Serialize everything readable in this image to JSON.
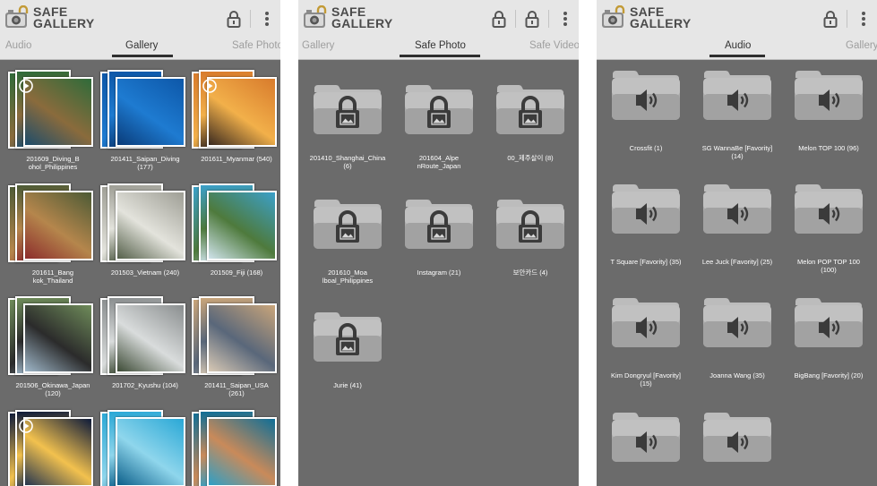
{
  "app": {
    "title": "SAFE\nGALLERY"
  },
  "icons": {
    "logo": "safe-camera-logo-icon",
    "lock": "lock-icon",
    "menu": "more-vert-icon",
    "play": "play-icon",
    "folder_lock": "folder-lock-icon",
    "folder_audio": "folder-speaker-icon"
  },
  "colors": {
    "background": "#6b6b6b",
    "toolbar": "#e6e6e6",
    "tab_active": "#333333",
    "tab_inactive": "#9e9e9e",
    "indicator": "#2f2f2f"
  },
  "screens": [
    {
      "tabs": [
        "Audio",
        "Gallery",
        "Safe Photo"
      ],
      "items": [
        {
          "label": "201609_Diving_B\nohol_Philippines",
          "video": true,
          "c": [
            "#2f6b3a",
            "#8a6b3c",
            "#1d4c6b"
          ]
        },
        {
          "label": "201411_Saipan_Diving\n(177)",
          "video": false,
          "c": [
            "#0d57a8",
            "#1e7bd1",
            "#0a3b78"
          ]
        },
        {
          "label": "201611_Myanmar (540)",
          "video": true,
          "c": [
            "#d87b2c",
            "#f2b04a",
            "#3a2a20"
          ]
        },
        {
          "label": "201611_Bang\nkok_Thailand",
          "video": false,
          "c": [
            "#4c5a35",
            "#b5864c",
            "#8c2c2c"
          ]
        },
        {
          "label": "201503_Vietnam (240)",
          "video": false,
          "c": [
            "#9e9e95",
            "#e3e3dc",
            "#55604a"
          ]
        },
        {
          "label": "201509_Fiji (168)",
          "video": false,
          "c": [
            "#3ba0c9",
            "#4e7a3c",
            "#cfe3ea"
          ]
        },
        {
          "label": "201506_Okinawa_Japan\n(120)",
          "video": false,
          "c": [
            "#6f8c5a",
            "#2b2b2b",
            "#9fb7c9"
          ]
        },
        {
          "label": "201702_Kyushu (104)",
          "video": false,
          "c": [
            "#8a8e8f",
            "#d9dcdc",
            "#3d4b36"
          ]
        },
        {
          "label": "201411_Saipan_USA\n(261)",
          "video": false,
          "c": [
            "#c9a57a",
            "#59677a",
            "#d8c9b5"
          ]
        },
        {
          "label": "",
          "video": true,
          "c": [
            "#0d1a3a",
            "#f2c14e",
            "#25354f"
          ]
        },
        {
          "label": "",
          "video": false,
          "c": [
            "#2aa8d6",
            "#8fd6ec",
            "#0c5f8a"
          ]
        },
        {
          "label": "",
          "video": false,
          "c": [
            "#0e6e97",
            "#c98a5a",
            "#2e9fc6"
          ]
        }
      ]
    },
    {
      "tabs": [
        "Gallery",
        "Safe Photo",
        "Safe Video"
      ],
      "items": [
        {
          "label": "201410_Shanghai_China\n(6)"
        },
        {
          "label": "201604_Alpe\nnRoute_Japan"
        },
        {
          "label": "00_제주살이 (8)"
        },
        {
          "label": "201610_Moa\nlboal_Philippines"
        },
        {
          "label": "Instagram (21)"
        },
        {
          "label": "보안카드 (4)"
        },
        {
          "label": "Jurie (41)"
        }
      ]
    },
    {
      "tabs": [
        "Audio",
        "Gallery"
      ],
      "items": [
        {
          "label": "Crossfit (1)"
        },
        {
          "label": "SG WannaBe [Favority]\n(14)"
        },
        {
          "label": "Melon TOP 100 (96)"
        },
        {
          "label": "T Square [Favority] (35)"
        },
        {
          "label": "Lee Juck [Favority] (25)"
        },
        {
          "label": "Melon POP TOP 100\n(100)"
        },
        {
          "label": "Kim Dongryul [Favority]\n(15)"
        },
        {
          "label": "Joanna Wang (35)"
        },
        {
          "label": "BigBang [Favority] (20)"
        },
        {
          "label": ""
        },
        {
          "label": ""
        }
      ]
    }
  ]
}
